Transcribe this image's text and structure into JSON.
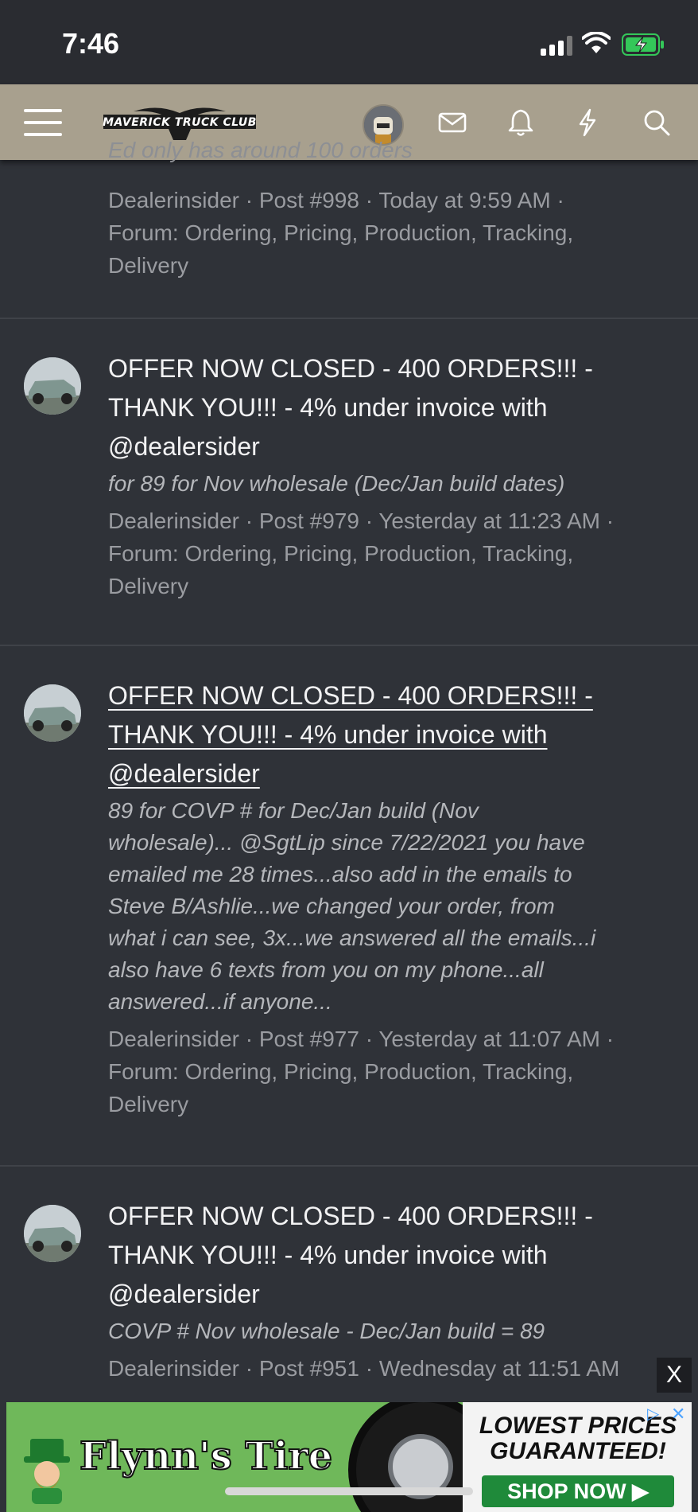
{
  "status_bar": {
    "time": "7:46"
  },
  "header": {
    "logo_text": "MAVERICK TRUCK CLUB"
  },
  "top_fragment": {
    "cut_line": "Ed only has around 100 orders",
    "meta_line1": "Dealerinsider · Post #998 · Today at 9:59 AM ·",
    "meta_line2": "Forum: Ordering, Pricing, Production, Tracking,",
    "meta_line3": "Delivery"
  },
  "results": [
    {
      "title_line1": "OFFER NOW CLOSED - 400 ORDERS!!! -",
      "title_line2": "THANK YOU!!! - 4% under invoice with",
      "title_line3": "@dealersider",
      "snippet": [
        "for 89 for Nov wholesale (Dec/Jan build dates)"
      ],
      "meta_line1": "Dealerinsider · Post #979 · Yesterday at 11:23 AM ·",
      "meta_line2": "Forum: Ordering, Pricing, Production, Tracking,",
      "meta_line3": "Delivery"
    },
    {
      "title_line1": "OFFER NOW CLOSED - 400 ORDERS!!! -",
      "title_line2": "THANK YOU!!! - 4% under invoice with",
      "title_line3": "@dealersider",
      "snippet": [
        "89 for COVP # for Dec/Jan build (Nov",
        "wholesale)... @SgtLip since 7/22/2021 you have",
        "emailed me 28 times...also add in the emails to",
        "Steve B/Ashlie...we changed your order, from",
        "what i can see, 3x...we answered all the emails...i",
        "also have 6 texts from you on my phone...all",
        "answered...if anyone..."
      ],
      "meta_line1": "Dealerinsider · Post #977 · Yesterday at 11:07 AM ·",
      "meta_line2": "Forum: Ordering, Pricing, Production, Tracking,",
      "meta_line3": "Delivery"
    },
    {
      "title_line1": "OFFER NOW CLOSED - 400 ORDERS!!! -",
      "title_line2": "THANK YOU!!! - 4% under invoice with",
      "title_line3": "@dealersider",
      "snippet": [
        "COVP # Nov wholesale - Dec/Jan build = 89"
      ],
      "meta_line1": "Dealerinsider · Post #951 · Wednesday at 11:51 AM",
      "meta_line2": "",
      "meta_line3": ""
    }
  ],
  "ad": {
    "close_label": "X",
    "brand": "Flynn's Tire",
    "headline_line1": "LOWEST PRICES",
    "headline_line2": "GUARANTEED!",
    "cta": "SHOP NOW ▶",
    "colors": {
      "background": "#6fb85a",
      "cta": "#1f8a3a"
    }
  },
  "colors": {
    "page_bg": "#2f3238",
    "header_bg": "#a8a08e",
    "meta_text": "#9a9ca1"
  }
}
